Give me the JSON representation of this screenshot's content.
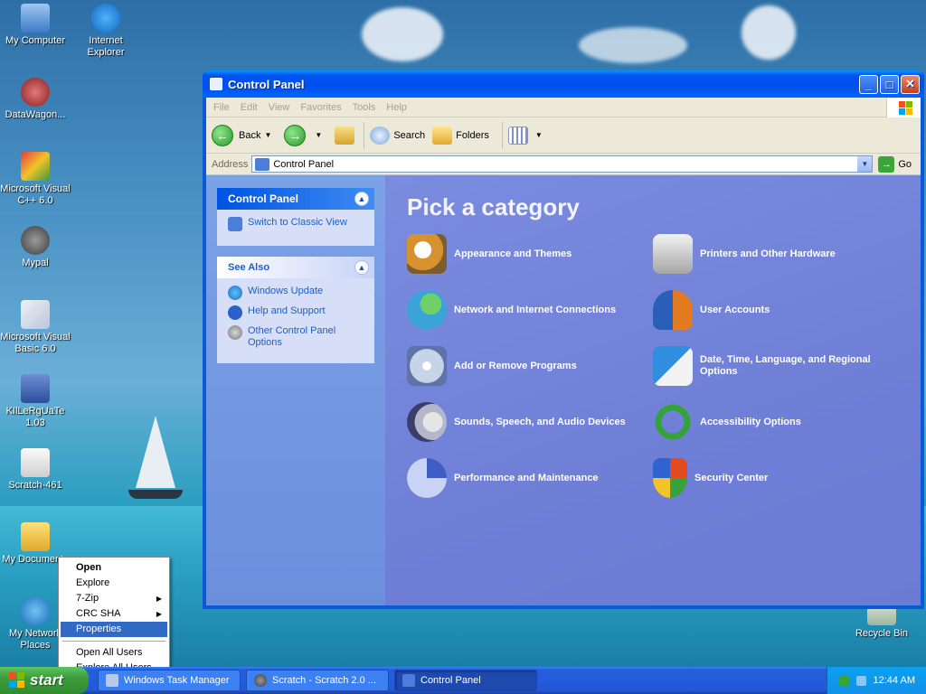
{
  "desktop": {
    "icons": [
      {
        "label": "My Computer"
      },
      {
        "label": "Internet Explorer"
      },
      {
        "label": "DataWagon..."
      },
      {
        "label": "Microsoft Visual C++ 6.0"
      },
      {
        "label": "Mypal"
      },
      {
        "label": "Microsoft Visual Basic 6.0"
      },
      {
        "label": "KIlLeRgUaTe 1.03"
      },
      {
        "label": "Scratch-461"
      },
      {
        "label": "My Documents"
      },
      {
        "label": "My Network Places"
      },
      {
        "label": "Recycle Bin"
      }
    ]
  },
  "window": {
    "title": "Control Panel",
    "buttons": {
      "minimize": "_",
      "maximize": "□",
      "close": "✕"
    },
    "menu": [
      "File",
      "Edit",
      "View",
      "Favorites",
      "Tools",
      "Help"
    ],
    "toolbar": {
      "back": "Back",
      "search": "Search",
      "folders": "Folders"
    },
    "address": {
      "label": "Address",
      "value": "Control Panel",
      "go": "Go"
    }
  },
  "leftpane": {
    "panel_title": "Control Panel",
    "switch_link": "Switch to Classic View",
    "see_also_title": "See Also",
    "see_also": [
      "Windows Update",
      "Help and Support",
      "Other Control Panel Options"
    ]
  },
  "main": {
    "heading": "Pick a category",
    "categories": [
      {
        "label": "Appearance and Themes",
        "icon": "appearance-icon",
        "color": "#d7922f"
      },
      {
        "label": "Printers and Other Hardware",
        "icon": "printer-icon",
        "color": "#cfcfcf"
      },
      {
        "label": "Network and Internet Connections",
        "icon": "network-icon",
        "color": "#3aa3d8"
      },
      {
        "label": "User Accounts",
        "icon": "users-icon",
        "color": "#e27a1f"
      },
      {
        "label": "Add or Remove Programs",
        "icon": "programs-icon",
        "color": "#c7d4e8"
      },
      {
        "label": "Date, Time, Language, and Regional Options",
        "icon": "datetime-icon",
        "color": "#2f8ee0"
      },
      {
        "label": "Sounds, Speech, and Audio Devices",
        "icon": "sound-icon",
        "color": "#b4b6c9"
      },
      {
        "label": "Accessibility Options",
        "icon": "accessibility-icon",
        "color": "#34a33a"
      },
      {
        "label": "Performance and Maintenance",
        "icon": "performance-icon",
        "color": "#8fa6e7"
      },
      {
        "label": "Security Center",
        "icon": "shield-icon",
        "color": "#2f63d2"
      }
    ]
  },
  "context_menu": {
    "items": [
      "Open",
      "Explore",
      "7-Zip",
      "CRC SHA",
      "Properties",
      "Open All Users",
      "Explore All Users"
    ],
    "selected": "Properties"
  },
  "taskbar": {
    "start": "start",
    "tasks": [
      "Windows Task Manager",
      "Scratch - Scratch 2.0 ...",
      "Control Panel"
    ],
    "clock": "12:44 AM"
  }
}
